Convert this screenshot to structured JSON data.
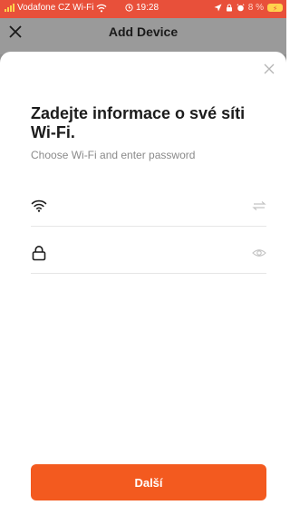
{
  "status_bar": {
    "carrier": "Vodafone CZ Wi-Fi",
    "time": "19:28",
    "battery": "8 %",
    "icons": [
      "signal-icon",
      "wifi-icon",
      "alarm-icon",
      "location-arrow-icon",
      "lock-rotation-icon",
      "battery-charging-icon"
    ]
  },
  "header": {
    "title": "Add Device",
    "close_icon": "close-icon"
  },
  "sheet": {
    "close_icon": "close-icon",
    "heading": "Zadejte informace o své síti Wi-Fi.",
    "subheading": "Choose Wi-Fi and enter password",
    "wifi_field": {
      "icon": "wifi-icon",
      "value": "",
      "placeholder": "",
      "action_icon": "swap-arrows-icon"
    },
    "password_field": {
      "icon": "lock-icon",
      "value": "",
      "placeholder": "",
      "action_icon": "eye-icon"
    },
    "next_label": "Další"
  },
  "colors": {
    "status_bar": "#e8503a",
    "accent": "#f35a1f",
    "overlay": "#9a9a9a"
  }
}
